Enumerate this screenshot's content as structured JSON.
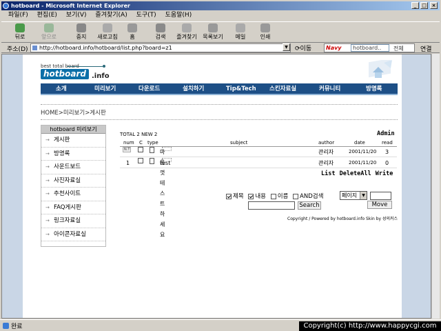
{
  "window": {
    "title": "hotboard - Microsoft Internet Explorer"
  },
  "menu": [
    "파일(F)",
    "편집(E)",
    "보기(V)",
    "즐겨찾기(A)",
    "도구(T)",
    "도움말(H)"
  ],
  "toolbar": {
    "back": "뒤로",
    "forward": "앞으로",
    "stop": "중지",
    "refresh": "새로고침",
    "home": "홈",
    "search": "검색",
    "favorites": "즐겨찾기",
    "history": "목록보기",
    "mail": "메일",
    "print": "인쇄"
  },
  "address": {
    "label": "주소(D)",
    "url": "http://hotboard.info/hotboard/list.php?board=z1",
    "go": "이동"
  },
  "navy": {
    "logo": "Navy",
    "placeholder": "hotboard..",
    "all": "전체",
    "links": "연결"
  },
  "site": {
    "tagline": "best total board",
    "logo": "hotboard",
    "logo_suffix": ".info",
    "nav": [
      "소개",
      "미리보기",
      "다운로드",
      "설치하기",
      "Tip&Tech",
      "스킨자료실",
      "커뮤니티",
      "방명록"
    ],
    "breadcrumb": "HOME>미리보기>게시판"
  },
  "sidebar": {
    "title": "hotboard 미리보기",
    "items": [
      "게시판",
      "방명록",
      "사운드보드",
      "사진자료실",
      "추천사이트",
      "FAQ게시판",
      "링크자료실",
      "아이콘자료실"
    ]
  },
  "board": {
    "total": "TOTAL 2 NEW 2",
    "admin": "Admin",
    "columns": {
      "num": "num",
      "c": "C",
      "type": "type",
      "subject": "subject",
      "author": "author",
      "date": "date",
      "read": "read"
    },
    "rows": [
      {
        "num": "N.T",
        "subject": "마음껏 테스트하세요",
        "author": "관리자",
        "date": "2001/11/20",
        "read": "3"
      },
      {
        "num": "1",
        "subject": "test",
        "author": "관리자",
        "date": "2001/11/20",
        "read": "0"
      }
    ],
    "actions": "List DeleteAll Write"
  },
  "search": {
    "opt_subject": "제목",
    "opt_content": "내용",
    "opt_name": "이름",
    "opt_and": "AND검색",
    "button": "Search",
    "page_select": "페이지",
    "move": "Move"
  },
  "footer": {
    "credit": "Copyright / Powered by hotboard.info Skin by 성의커스"
  },
  "status": {
    "text": "완료",
    "banner": "Copyright(c) http://www.happycgi.com"
  }
}
